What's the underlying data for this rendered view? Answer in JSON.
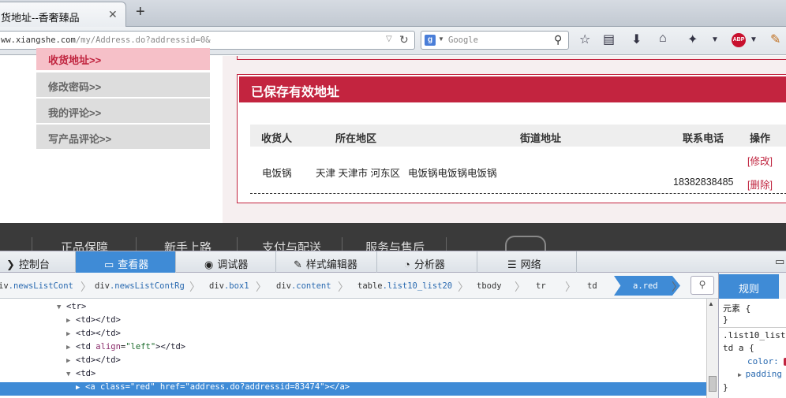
{
  "browser": {
    "tab_title": "货地址--香奢臻品",
    "tab_close": "✕",
    "new_tab": "+",
    "url_host": "ww.xiangshe.com",
    "url_path": "/my/Address.do?addressid=0&",
    "search_engine_letter": "g",
    "search_placeholder": "Google"
  },
  "sidebar": {
    "items": [
      {
        "label": "收货地址>>",
        "active": true
      },
      {
        "label": "修改密码>>"
      },
      {
        "label": "我的评论>>"
      },
      {
        "label": "写产品评论>>"
      }
    ]
  },
  "address_panel": {
    "title": "已保存有效地址",
    "columns": [
      "收货人",
      "所在地区",
      "街道地址",
      "联系电话",
      "操作"
    ],
    "row": {
      "name": "电饭锅",
      "region": "天津 天津市 河东区",
      "street": "电饭锅电饭锅电饭锅",
      "phone": "18382838485",
      "edit": "[修改]",
      "delete": "[删除]"
    }
  },
  "footer": {
    "items": [
      "正品保障",
      "新手上路",
      "支付与配送",
      "服务与售后"
    ]
  },
  "devtools": {
    "tabs": [
      {
        "label": "控制台",
        "icon": "console-icon"
      },
      {
        "label": "查看器",
        "icon": "inspector-icon",
        "active": true
      },
      {
        "label": "调试器",
        "icon": "debugger-icon"
      },
      {
        "label": "样式编辑器",
        "icon": "style-editor-icon"
      },
      {
        "label": "分析器",
        "icon": "profiler-icon"
      },
      {
        "label": "网络",
        "icon": "network-icon"
      }
    ],
    "breadcrumbs": [
      {
        "tag": "iv",
        "cls": ".newsListCont"
      },
      {
        "tag": "div",
        "cls": ".newsListContRg"
      },
      {
        "tag": "div",
        "cls": ".box1"
      },
      {
        "tag": "div",
        "cls": ".content"
      },
      {
        "tag": "table",
        "cls": ".list10_list20"
      },
      {
        "tag": "tbody",
        "cls": ""
      },
      {
        "tag": "tr",
        "cls": ""
      },
      {
        "tag": "td",
        "cls": ""
      }
    ],
    "active_crumb": "a.red",
    "dom": {
      "tr_open": "<tr>",
      "td1": "<td></td>",
      "td2": "<td></td>",
      "td3_open": "<td ",
      "td3_attr": "align",
      "td3_val": "\"left\"",
      "td3_close": "></td>",
      "td4": "<td></td>",
      "td5_open": "<td>",
      "sel_open": "<a ",
      "sel_attr1": "class",
      "sel_val1": "\"red\"",
      "sel_attr2": "href",
      "sel_val2": "\"address.do?addressid=83474\"",
      "sel_close": "></a>"
    },
    "rules_tab": "规则",
    "rules": {
      "l1": "元素 {",
      "l2": "}",
      "l3": ".list10_list",
      "l4": "td a {",
      "l5": "color: ",
      "l6": "padding",
      "l7": "}"
    }
  }
}
